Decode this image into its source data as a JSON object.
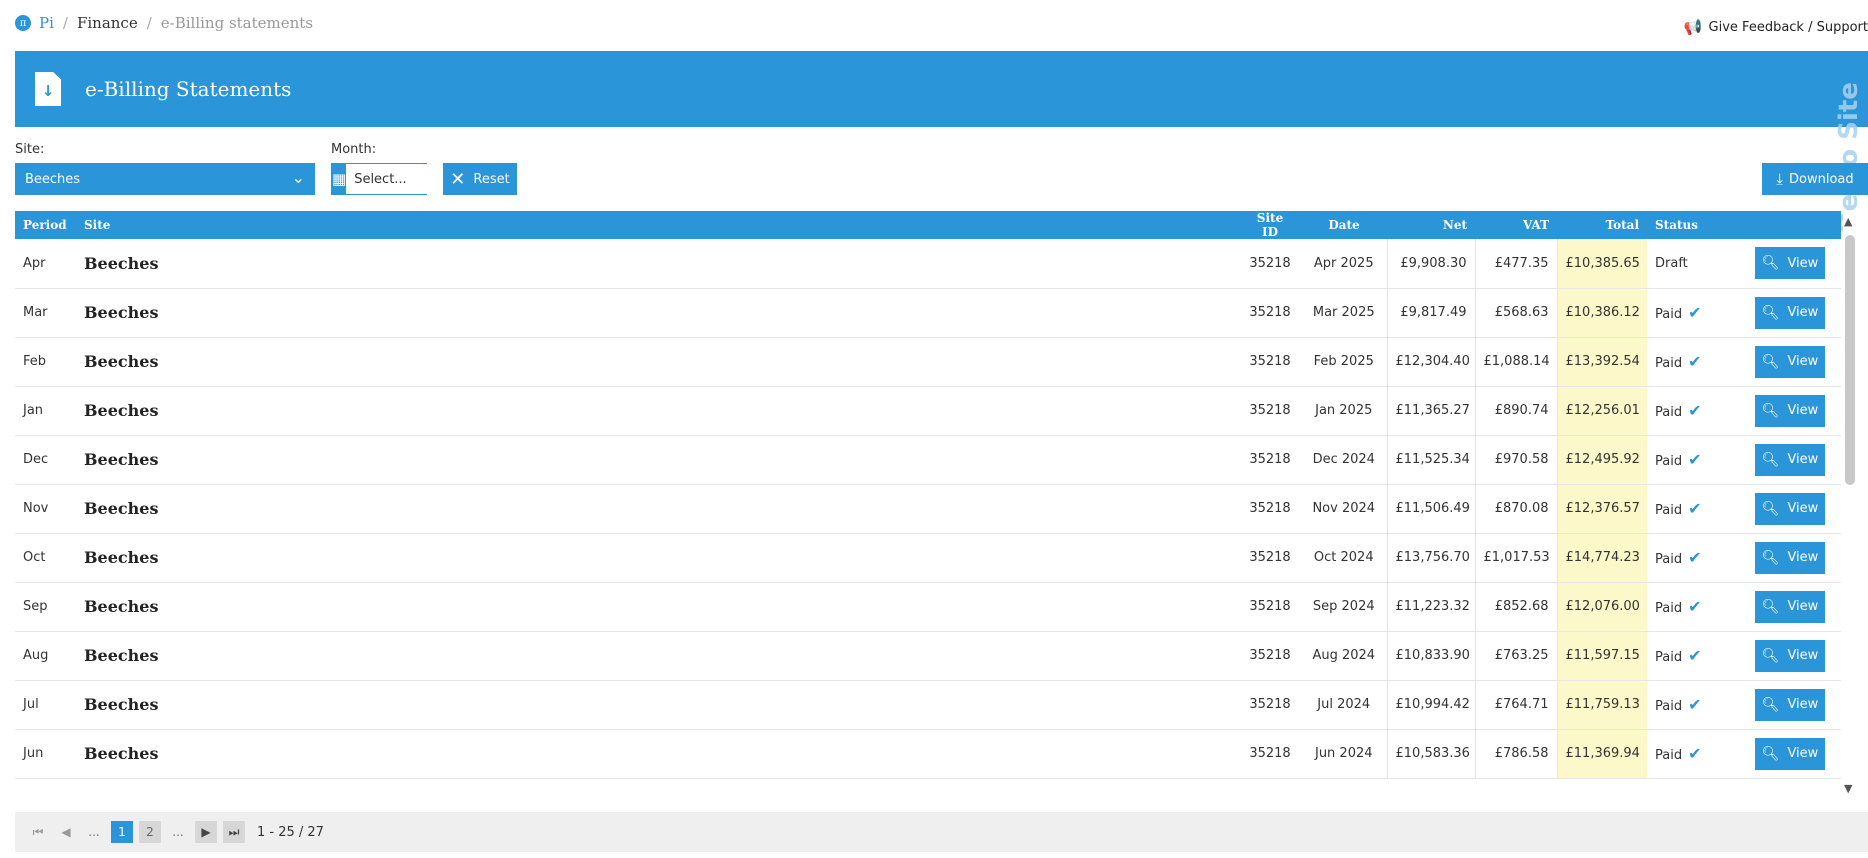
{
  "breadcrumb": {
    "logo": "π",
    "items": [
      "Pi",
      "Finance",
      "e-Billing statements"
    ],
    "separator": "/"
  },
  "feedback": {
    "label": "Give Feedback / Support",
    "icon": "megaphone-icon"
  },
  "header": {
    "title": "e-Billing Statements",
    "icon": "download-document-icon",
    "watermark": "Demo Site"
  },
  "filters": {
    "site_label": "Site:",
    "site_value": "Beeches",
    "month_label": "Month:",
    "month_placeholder": "Select...",
    "reset_label": "Reset",
    "download_label": "Download"
  },
  "table": {
    "columns": [
      "Period",
      "Site",
      "Site ID",
      "Date",
      "Net",
      "VAT",
      "Total",
      "Status",
      ""
    ],
    "view_label": "View",
    "rows": [
      {
        "period": "Apr",
        "site": "Beeches",
        "site_id": "35218",
        "date": "Apr 2025",
        "net": "£9,908.30",
        "vat": "£477.35",
        "total": "£10,385.65",
        "status": "Draft"
      },
      {
        "period": "Mar",
        "site": "Beeches",
        "site_id": "35218",
        "date": "Mar 2025",
        "net": "£9,817.49",
        "vat": "£568.63",
        "total": "£10,386.12",
        "status": "Paid"
      },
      {
        "period": "Feb",
        "site": "Beeches",
        "site_id": "35218",
        "date": "Feb 2025",
        "net": "£12,304.40",
        "vat": "£1,088.14",
        "total": "£13,392.54",
        "status": "Paid"
      },
      {
        "period": "Jan",
        "site": "Beeches",
        "site_id": "35218",
        "date": "Jan 2025",
        "net": "£11,365.27",
        "vat": "£890.74",
        "total": "£12,256.01",
        "status": "Paid"
      },
      {
        "period": "Dec",
        "site": "Beeches",
        "site_id": "35218",
        "date": "Dec 2024",
        "net": "£11,525.34",
        "vat": "£970.58",
        "total": "£12,495.92",
        "status": "Paid"
      },
      {
        "period": "Nov",
        "site": "Beeches",
        "site_id": "35218",
        "date": "Nov 2024",
        "net": "£11,506.49",
        "vat": "£870.08",
        "total": "£12,376.57",
        "status": "Paid"
      },
      {
        "period": "Oct",
        "site": "Beeches",
        "site_id": "35218",
        "date": "Oct 2024",
        "net": "£13,756.70",
        "vat": "£1,017.53",
        "total": "£14,774.23",
        "status": "Paid"
      },
      {
        "period": "Sep",
        "site": "Beeches",
        "site_id": "35218",
        "date": "Sep 2024",
        "net": "£11,223.32",
        "vat": "£852.68",
        "total": "£12,076.00",
        "status": "Paid"
      },
      {
        "period": "Aug",
        "site": "Beeches",
        "site_id": "35218",
        "date": "Aug 2024",
        "net": "£10,833.90",
        "vat": "£763.25",
        "total": "£11,597.15",
        "status": "Paid"
      },
      {
        "period": "Jul",
        "site": "Beeches",
        "site_id": "35218",
        "date": "Jul 2024",
        "net": "£10,994.42",
        "vat": "£764.71",
        "total": "£11,759.13",
        "status": "Paid"
      },
      {
        "period": "Jun",
        "site": "Beeches",
        "site_id": "35218",
        "date": "Jun 2024",
        "net": "£10,583.36",
        "vat": "£786.58",
        "total": "£11,369.94",
        "status": "Paid"
      }
    ]
  },
  "pager": {
    "pages": [
      "1",
      "2"
    ],
    "active": "1",
    "ellipsis": "...",
    "info": "1 - 25 / 27"
  },
  "colors": {
    "accent": "#2b95d9",
    "total_highlight": "#fdf8c9"
  }
}
